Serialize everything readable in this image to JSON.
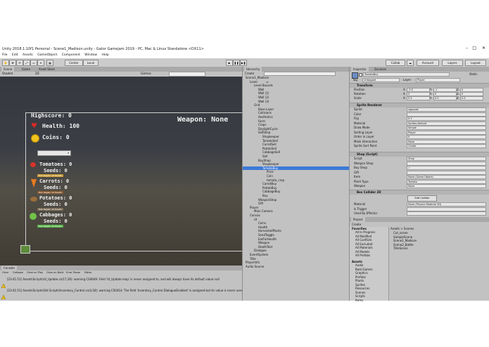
{
  "window": {
    "title": "Unity 2018.1.10f1 Personal - Scene1_Madison.unity - Gator Gamejam 2019 - PC, Mac & Linux Standalone <DX11>"
  },
  "menu": [
    "File",
    "Edit",
    "Assets",
    "GameObject",
    "Component",
    "Window",
    "Help"
  ],
  "toolbar": {
    "center": "Center",
    "local": "Local",
    "collab": "Collab",
    "account": "Account",
    "layers": "Layers",
    "layout": "Layout"
  },
  "scene": {
    "tabs": [
      "Scene",
      "Game",
      "Asset Store"
    ],
    "shaded": "Shaded",
    "mode2d": "2D",
    "gizmos": "Gizmos",
    "search": "All",
    "hud": {
      "highscore": "Highscore: 0",
      "health": "Health: 100",
      "coins": "Coins: 0",
      "weapon": "Weapon: None",
      "seeds_dropdown": "Seeds: Tomato",
      "crops": [
        {
          "name": "Tomatoes: 0",
          "seeds": "Seeds: 0",
          "button": "Eat: Regain 10 Health"
        },
        {
          "name": "Carrots: 0",
          "seeds": "Seeds: 0",
          "button": "Eat: Regain 10 Health"
        },
        {
          "name": "Potatoes: 0",
          "seeds": "Seeds: 0",
          "button": "Eat: Regain 10 Health"
        },
        {
          "name": "Cabbages: 0",
          "seeds": "Seeds: 0",
          "button": "Eat: Regain 10 Health"
        }
      ]
    }
  },
  "console": {
    "tab": "Console",
    "buttons": [
      "Clear",
      "Collapse",
      "Clear on Play",
      "Clear on Build",
      "Error Pause",
      "Editor"
    ],
    "messages": [
      "[23:41:51] Assets\\Scripts\\UI_Update.cs(17,26): warning CS0649: Field 'UI_Update.map' is never assigned to, and will always have its default value null",
      "[23:41:51] Assets\\Scripts\\Old Scripts\\Inventory_Control.cs(4,18): warning CS0414: The field 'Inventory_Control.DialogueEnabled' is assigned but its value is never used"
    ]
  },
  "hierarchy": {
    "tab": "Hierarchy",
    "create": "Create",
    "search": "All",
    "items": [
      {
        "label": "Scene1_Madison",
        "depth": 0
      },
      {
        "label": "Level",
        "depth": 1
      },
      {
        "label": "Level Bounds",
        "depth": 2
      },
      {
        "label": "Wall",
        "depth": 3
      },
      {
        "label": "Wall (1)",
        "depth": 3
      },
      {
        "label": "Wall (2)",
        "depth": 3
      },
      {
        "label": "Wall (3)",
        "depth": 3
      },
      {
        "label": "Grid",
        "depth": 2
      },
      {
        "label": "Base Layer",
        "depth": 3
      },
      {
        "label": "Collisions",
        "depth": 3
      },
      {
        "label": "Aesthetics",
        "depth": 3
      },
      {
        "label": "Farm",
        "depth": 3
      },
      {
        "label": "Crops",
        "depth": 3
      },
      {
        "label": "DaylightCycle",
        "depth": 3
      },
      {
        "label": "SellShop",
        "depth": 3
      },
      {
        "label": "Shopkeeper",
        "depth": 4
      },
      {
        "label": "TomatoSell",
        "depth": 4
      },
      {
        "label": "CarrotSell",
        "depth": 4
      },
      {
        "label": "PotatoSell",
        "depth": 4
      },
      {
        "label": "CabbageSell",
        "depth": 4
      },
      {
        "label": "Sell",
        "depth": 4
      },
      {
        "label": "BuyShop",
        "depth": 3
      },
      {
        "label": "Shopkeeper",
        "depth": 4
      },
      {
        "label": "TomatoBuy",
        "depth": 4,
        "selected": true
      },
      {
        "label": "Price",
        "depth": 5
      },
      {
        "label": "Coin",
        "depth": 5
      },
      {
        "label": "tomato_crop",
        "depth": 5
      },
      {
        "label": "CarrotBuy",
        "depth": 4
      },
      {
        "label": "PotatoBuy",
        "depth": 4
      },
      {
        "label": "CabbageBuy",
        "depth": 4
      },
      {
        "label": "Buy",
        "depth": 4
      },
      {
        "label": "WeaponShop",
        "depth": 3
      },
      {
        "label": "Gift",
        "depth": 3
      },
      {
        "label": "Player",
        "depth": 1
      },
      {
        "label": "Main Camera",
        "depth": 2
      },
      {
        "label": "Canvas",
        "depth": 1
      },
      {
        "label": "UI",
        "depth": 2
      },
      {
        "label": "Coins",
        "depth": 3
      },
      {
        "label": "Health",
        "depth": 3
      },
      {
        "label": "HarvestedPlants",
        "depth": 3
      },
      {
        "label": "SeedToggle",
        "depth": 3
      },
      {
        "label": "EatForHealth",
        "depth": 3
      },
      {
        "label": "Weapon",
        "depth": 3
      },
      {
        "label": "DeathText",
        "depth": 3
      },
      {
        "label": "Dialogue",
        "depth": 2
      },
      {
        "label": "EventSystem",
        "depth": 1
      },
      {
        "label": "Title",
        "depth": 1
      },
      {
        "label": "PlayerInfo",
        "depth": 0
      },
      {
        "label": "Audio Source",
        "depth": 0
      }
    ]
  },
  "inspector": {
    "tabs": [
      "Inspector",
      "Services"
    ],
    "object": "TomatoBuy",
    "static": "Static",
    "tag_label": "Tag",
    "tag": "Untagged",
    "layer_label": "Layer",
    "layer": "Player",
    "transform": {
      "header": "Transform",
      "rows": [
        {
          "label": "Position",
          "x": "-3.5",
          "y": "-1",
          "z": "0"
        },
        {
          "label": "Rotation",
          "x": "0",
          "y": "0",
          "z": "0"
        },
        {
          "label": "Scale",
          "x": "0.5",
          "y": "0.5",
          "z": "0.5"
        }
      ]
    },
    "sprite_renderer": {
      "header": "Sprite Renderer",
      "rows": [
        {
          "label": "Sprite",
          "value": "signpost"
        },
        {
          "label": "Color",
          "value": ""
        },
        {
          "label": "Flip",
          "value": "X  Y"
        },
        {
          "label": "Material",
          "value": "Sprites-Default"
        },
        {
          "label": "Draw Mode",
          "value": "Simple"
        },
        {
          "label": "Sorting Layer",
          "value": "Player"
        },
        {
          "label": "Order in Layer",
          "value": "0"
        },
        {
          "label": "Mask Interaction",
          "value": "None"
        },
        {
          "label": "Sprite Sort Point",
          "value": "Center"
        }
      ]
    },
    "shop": {
      "header": "Shop (Script)",
      "rows": [
        {
          "label": "Script",
          "value": "Shop"
        },
        {
          "label": "Weapon Shop",
          "value": ""
        },
        {
          "label": "Buy Shop",
          "value": "✓"
        },
        {
          "label": "Gift",
          "value": ""
        },
        {
          "label": "Item",
          "value": "None (Game Object)"
        },
        {
          "label": "Plant Type",
          "value": "Tomato"
        },
        {
          "label": "Weapon",
          "value": "None"
        }
      ]
    },
    "box_collider": {
      "header": "Box Collider 2D",
      "edit": "Edit Collider",
      "rows": [
        {
          "label": "Material",
          "value": "None (Physics Material 2D)"
        },
        {
          "label": "Is Trigger",
          "value": ""
        },
        {
          "label": "Used By Effector",
          "value": ""
        }
      ]
    }
  },
  "project": {
    "tab": "Project",
    "create": "Create",
    "favorites": {
      "label": "Favorites",
      "items": [
        "All In Progress",
        "All Modified",
        "All Conflicts",
        "All Excluded",
        "All Materials",
        "All Models",
        "All Prefabs"
      ]
    },
    "assets_tree": {
      "label": "Assets",
      "items": [
        "Audio",
        "BasicGames",
        "Graphics",
        "Prefabs",
        "Plants",
        "Sprites",
        "Resources",
        "Scenes",
        "Scripts",
        "Items"
      ]
    },
    "breadcrumb": "Assets > Scenes",
    "files": [
      "Cut_scene",
      "SampleScene",
      "Scene1_Madison",
      "Scene2_Battle",
      "TitleScene"
    ]
  }
}
